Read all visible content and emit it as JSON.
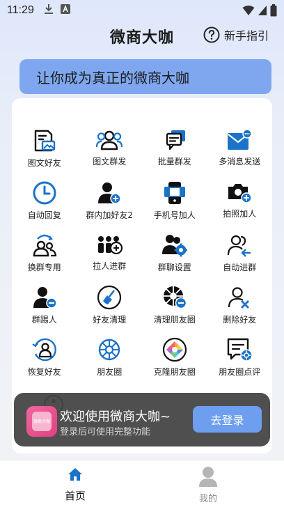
{
  "status_bar": {
    "time": "11:29",
    "icons": [
      "download-icon",
      "a-badge-icon",
      "wifi-icon",
      "signal-icon",
      "battery-icon"
    ]
  },
  "header": {
    "title": "微商大咖",
    "guide_label": "新手指引"
  },
  "banner": {
    "text": "让你成为真正的微商大咖"
  },
  "colors": {
    "accent": "#6d9ef0",
    "banner": "#7fa7ef",
    "icon_blue": "#1a73c9",
    "toast_bg": "#444444"
  },
  "grid": {
    "items": [
      {
        "label": "图文好友",
        "icon": "image-text-icon"
      },
      {
        "label": "图文群发",
        "icon": "group-people-icon"
      },
      {
        "label": "批量群发",
        "icon": "batch-messages-icon"
      },
      {
        "label": "多消息发送",
        "icon": "envelope-icon"
      },
      {
        "label": "自动回复",
        "icon": "clock-icon"
      },
      {
        "label": "群内加好友2",
        "icon": "add-user-icon"
      },
      {
        "label": "手机号加人",
        "icon": "phone-icon"
      },
      {
        "label": "拍照加人",
        "icon": "camera-add-icon"
      },
      {
        "label": "换群专用",
        "icon": "switch-group-icon"
      },
      {
        "label": "拉人进群",
        "icon": "pull-people-icon"
      },
      {
        "label": "群聊设置",
        "icon": "group-settings-icon"
      },
      {
        "label": "自动进群",
        "icon": "auto-join-icon"
      },
      {
        "label": "群踢人",
        "icon": "kick-member-icon"
      },
      {
        "label": "好友清理",
        "icon": "broom-icon"
      },
      {
        "label": "清理朋友圈",
        "icon": "clean-moments-icon"
      },
      {
        "label": "删除好友",
        "icon": "delete-friend-icon"
      },
      {
        "label": "恢复好友",
        "icon": "restore-friend-icon"
      },
      {
        "label": "朋友圈",
        "icon": "moments-icon"
      },
      {
        "label": "克隆朋友圈",
        "icon": "clone-moments-icon"
      },
      {
        "label": "朋友圈点评",
        "icon": "moments-comment-icon"
      }
    ]
  },
  "toast": {
    "title": "欢迎使用微商大咖~",
    "subtitle": "登录后可使用完整功能",
    "login_label": "去登录",
    "logo_text": "微商大咖"
  },
  "bottom_nav": {
    "home_label": "首页",
    "mine_label": "我的"
  }
}
